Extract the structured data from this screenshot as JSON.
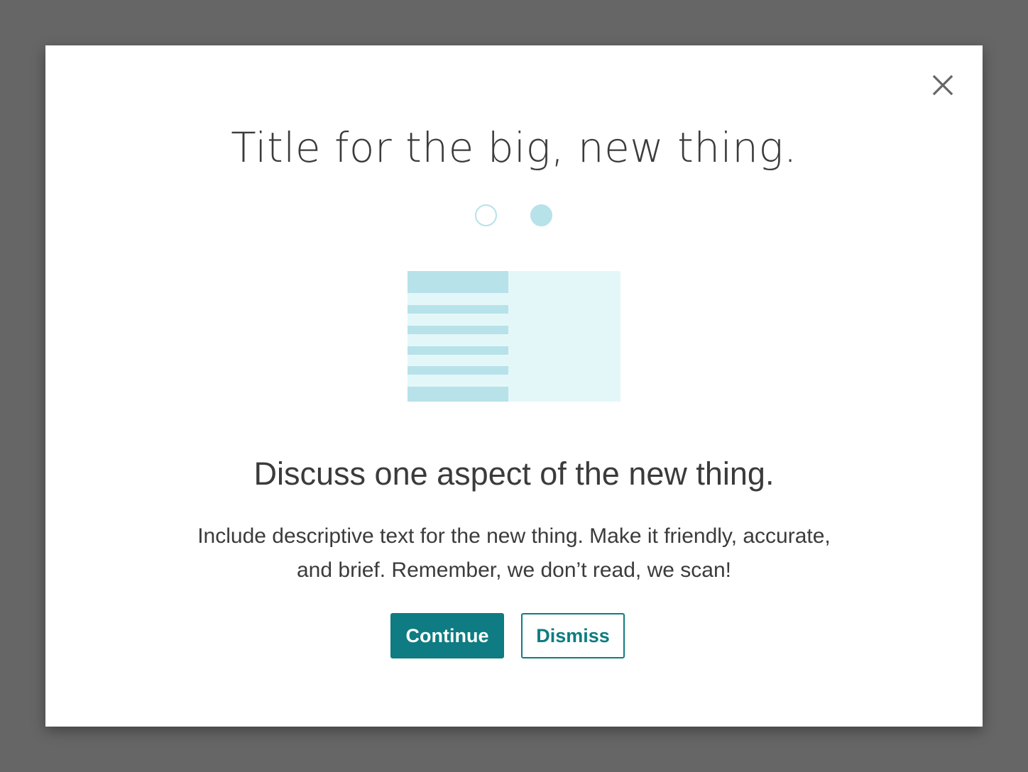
{
  "modal": {
    "title": "Title for the big, new thing.",
    "heading": "Discuss one aspect of the new thing.",
    "description": "Include descriptive text for the new thing.  Make it friendly, accurate, and brief. Remember, we don’t read, we scan!",
    "close_icon": "close-icon",
    "pager": {
      "total": 2,
      "current": 2
    },
    "buttons": {
      "continue_label": "Continue",
      "dismiss_label": "Dismiss"
    }
  },
  "colors": {
    "backdrop": "#666666",
    "accent": "#0e7c82",
    "illustration_light": "#e3f7f9",
    "illustration_mid": "#b7e2e9",
    "text": "#3b3b3b"
  }
}
